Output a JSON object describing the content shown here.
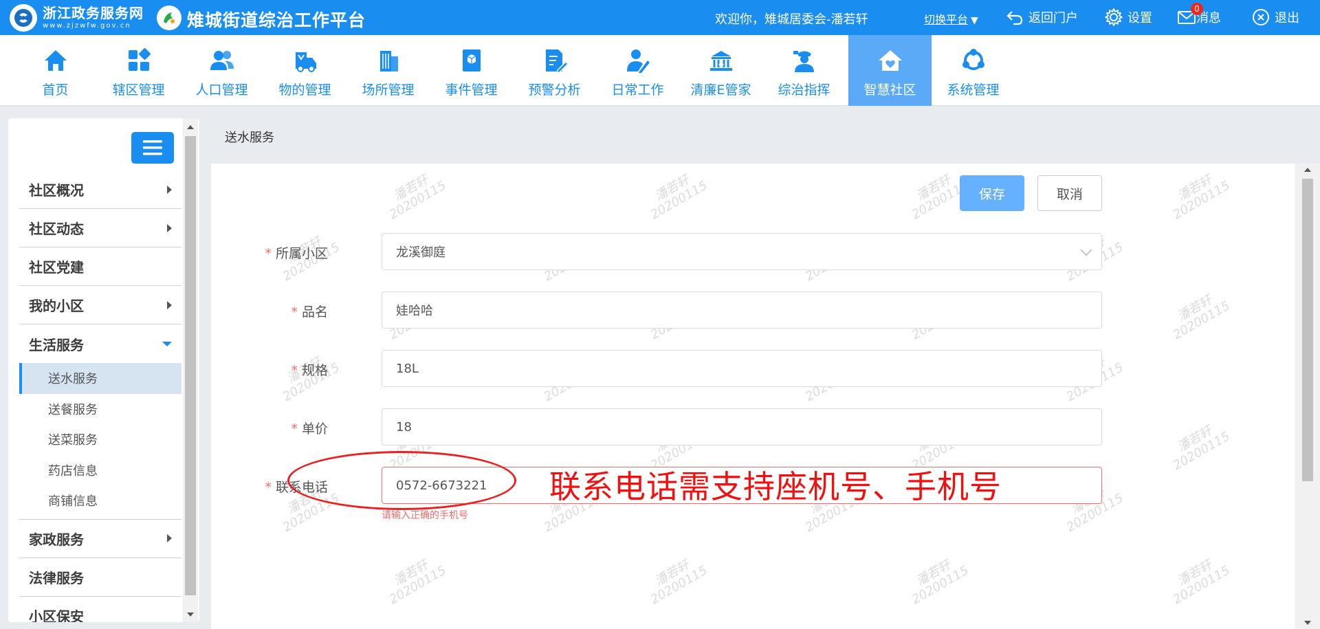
{
  "topbar": {
    "brand_name": "浙江政务服务网",
    "brand_url": "www.zjzwfw.gov.cn",
    "platform_title": "雉城街道综治工作平台",
    "welcome": "欢迎你，雉城居委会-潘若轩",
    "switch_label": "切换平台",
    "switch_arrow": "▼",
    "return_label": "返回门户",
    "settings_label": "设置",
    "messages_label": "消息",
    "messages_count": "0",
    "logout_label": "退出"
  },
  "nav": {
    "items": [
      {
        "label": "首页",
        "icon": "home-icon"
      },
      {
        "label": "辖区管理",
        "icon": "grid-icon"
      },
      {
        "label": "人口管理",
        "icon": "people-icon"
      },
      {
        "label": "物的管理",
        "icon": "vehicle-icon"
      },
      {
        "label": "场所管理",
        "icon": "building-icon"
      },
      {
        "label": "事件管理",
        "icon": "event-book-icon"
      },
      {
        "label": "预警分析",
        "icon": "document-edit-icon"
      },
      {
        "label": "日常工作",
        "icon": "user-pen-icon"
      },
      {
        "label": "清廉E管家",
        "icon": "landmark-icon"
      },
      {
        "label": "综治指挥",
        "icon": "officer-icon"
      },
      {
        "label": "智慧社区",
        "icon": "house-heart-icon"
      },
      {
        "label": "系统管理",
        "icon": "network-icon"
      }
    ],
    "active_color": "#5aaaf7"
  },
  "sidebar": {
    "items": [
      {
        "label": "社区概况"
      },
      {
        "label": "社区动态"
      },
      {
        "label": "社区党建"
      },
      {
        "label": "我的小区"
      },
      {
        "label": "生活服务"
      }
    ],
    "sub_items": [
      {
        "label": "送水服务"
      },
      {
        "label": "送餐服务"
      },
      {
        "label": "送菜服务"
      },
      {
        "label": "药店信息"
      },
      {
        "label": "商铺信息"
      }
    ],
    "items_after": [
      {
        "label": "家政服务"
      },
      {
        "label": "法律服务"
      },
      {
        "label": "小区保安"
      }
    ]
  },
  "page": {
    "title": "送水服务"
  },
  "form": {
    "save_label": "保存",
    "cancel_label": "取消",
    "required_mark": "*",
    "fields": [
      {
        "label": "所属小区",
        "value": "龙溪御庭"
      },
      {
        "label": "品名",
        "value": "娃哈哈"
      },
      {
        "label": "规格",
        "value": "18L"
      },
      {
        "label": "单价",
        "value": "18"
      },
      {
        "label": "联系电话",
        "value": "0572-6673221"
      }
    ],
    "error_message": "请输入正确的手机号"
  },
  "annotation": {
    "text": "联系电话需支持座机号、手机号",
    "color": "#f01010"
  },
  "watermark": {
    "name": "潘若轩",
    "date": "20200115"
  },
  "colors": {
    "primary": "#1a8ef0",
    "save_button": "#66b1ff",
    "error": "#f56c6c"
  }
}
